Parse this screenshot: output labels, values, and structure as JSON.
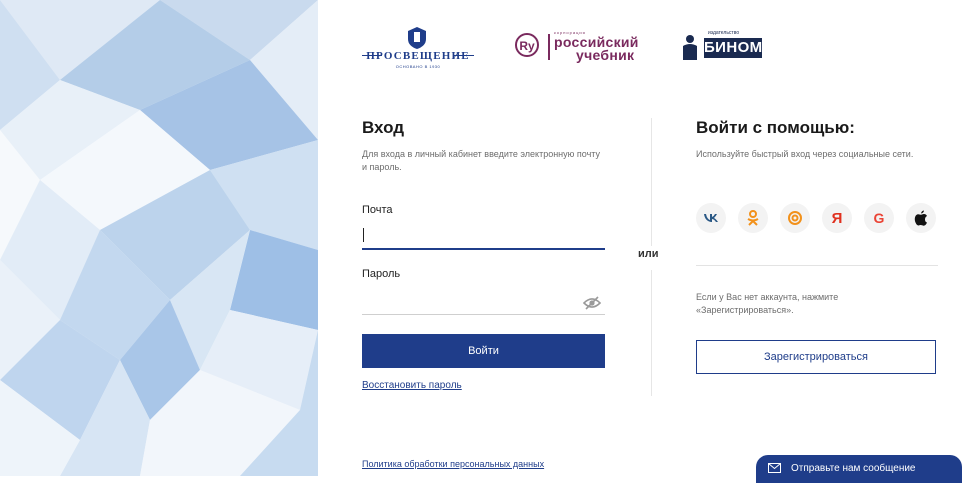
{
  "logos": {
    "prosv_name": "ПРОСВЕЩЕНИЕ",
    "prosv_since": "ОСНОВАНО В 1930",
    "ru_corp": "корпорация",
    "ru_line1": "российский",
    "ru_line2": "учебник",
    "binom_pub": "издательство",
    "binom_name": "БИНОМ"
  },
  "login": {
    "title": "Вход",
    "description": "Для входа в личный кабинет введите электронную почту и пароль.",
    "email_label": "Почта",
    "email_value": "",
    "password_label": "Пароль",
    "password_value": "",
    "submit_label": "Войти",
    "restore_link": "Восстановить пароль"
  },
  "or_label": "или",
  "social": {
    "title": "Войти с помощью:",
    "description": "Используйте быстрый вход через социальные сети.",
    "providers": [
      "vk",
      "odnoklassniki",
      "mail.ru",
      "yandex",
      "google",
      "apple"
    ],
    "no_account_text": "Если у Вас нет аккаунта, нажмите «Зарегистрироваться».",
    "register_label": "Зарегистрироваться"
  },
  "footer": {
    "policy_link": "Политика обработки персональных данных"
  },
  "chat": {
    "label": "Отправьте нам сообщение"
  },
  "colors": {
    "primary": "#1f3d8a",
    "ru_brand": "#7a2a5e",
    "vk": "#2a5885",
    "ok": "#f2911b",
    "mail": "#f2911b",
    "yandex": "#e0301e",
    "google": "#ea4335",
    "apple": "#111111"
  }
}
